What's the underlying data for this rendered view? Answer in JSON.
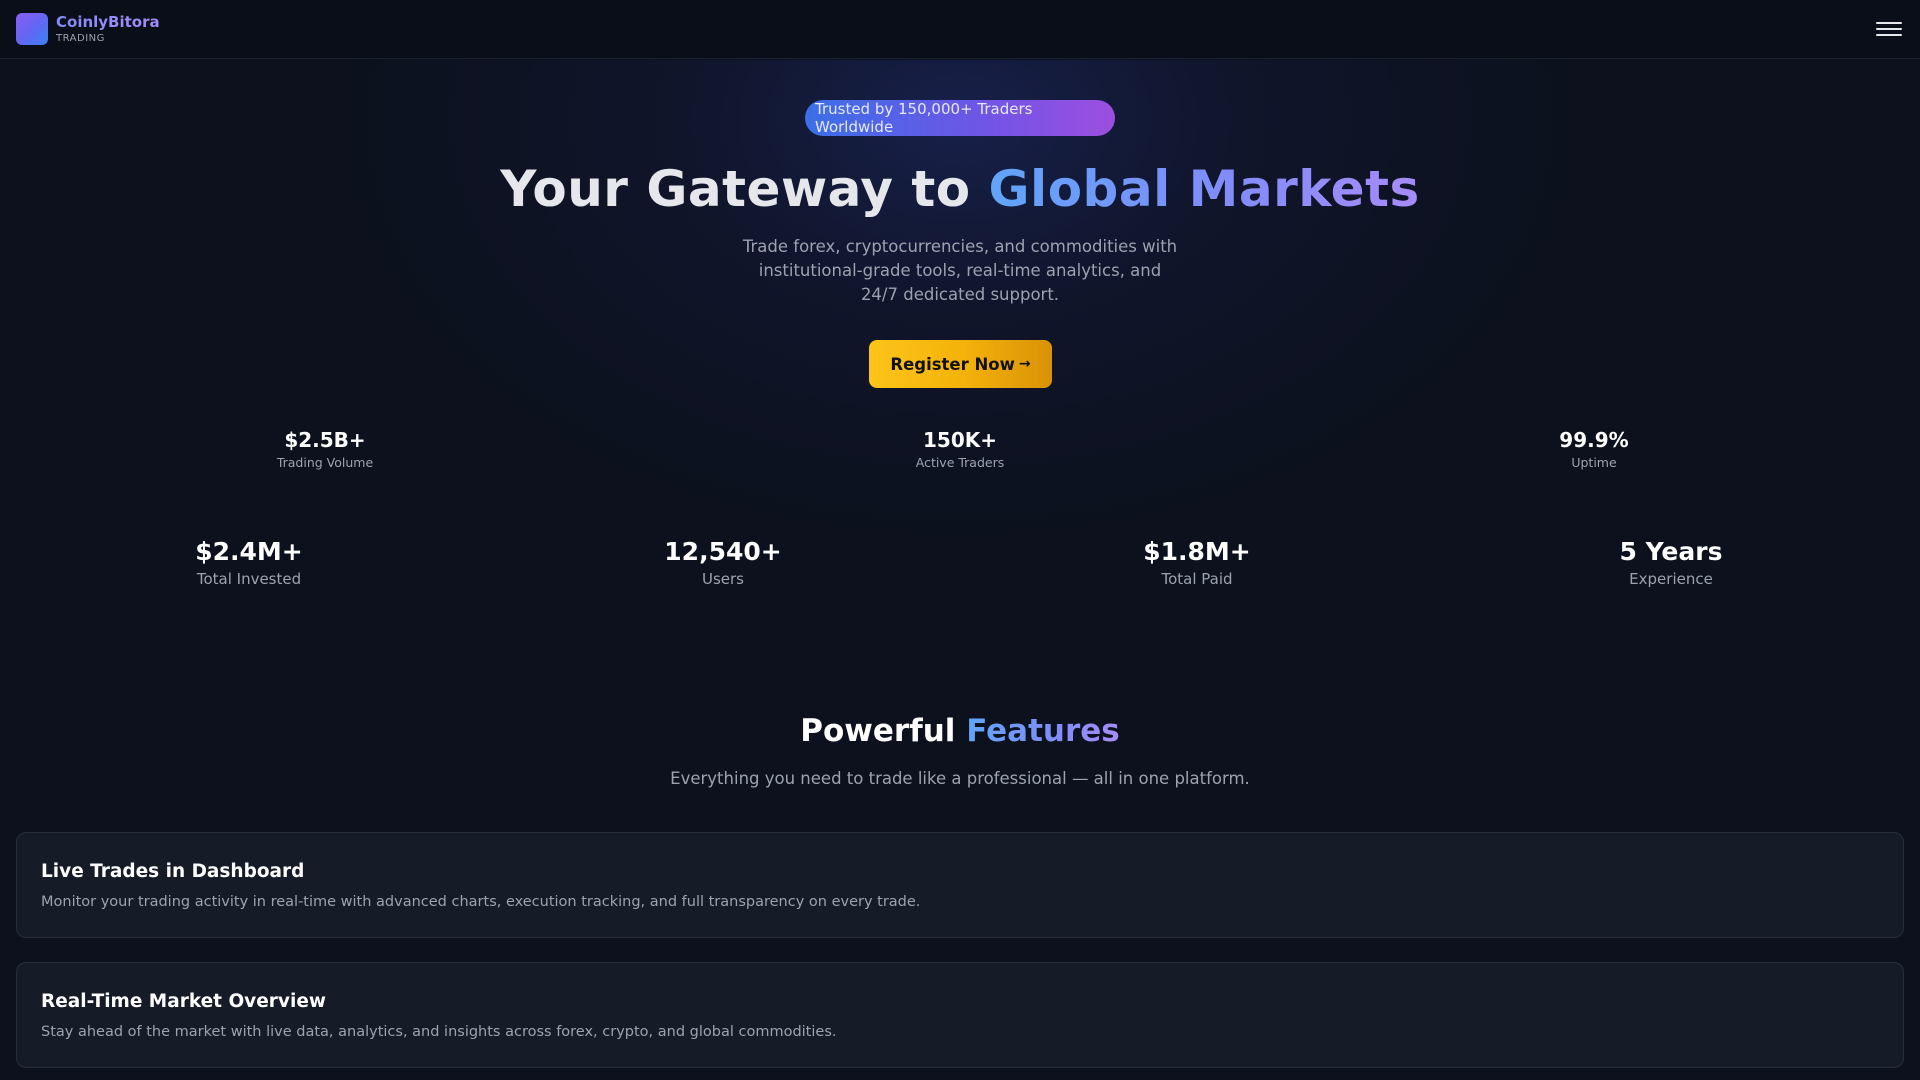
{
  "header": {
    "brand_name": "CoinlyBitora",
    "brand_sub": "TRADING"
  },
  "hero": {
    "badge": "Trusted by 150,000+ Traders Worldwide",
    "title_plain": "Your Gateway to ",
    "title_accent": "Global Markets",
    "subtitle": "Trade forex, cryptocurrencies, and commodities with institutional-grade tools, real-time analytics, and 24/7 dedicated support.",
    "cta_label": "Register Now",
    "cta_arrow": "→",
    "stats": [
      {
        "value": "$2.5B+",
        "label": "Trading Volume"
      },
      {
        "value": "150K+",
        "label": "Active Traders"
      },
      {
        "value": "99.9%",
        "label": "Uptime"
      }
    ]
  },
  "stats": [
    {
      "value": "$2.4M+",
      "label": "Total Invested"
    },
    {
      "value": "12,540+",
      "label": "Users"
    },
    {
      "value": "$1.8M+",
      "label": "Total Paid"
    },
    {
      "value": "5 Years",
      "label": "Experience"
    }
  ],
  "features": {
    "title_plain": "Powerful ",
    "title_accent": "Features",
    "subtitle": "Everything you need to trade like a professional — all in one platform.",
    "cards": [
      {
        "title": "Live Trades in Dashboard",
        "description": "Monitor your trading activity in real-time with advanced charts, execution tracking, and full transparency on every trade."
      },
      {
        "title": "Real-Time Market Overview",
        "description": "Stay ahead of the market with live data, analytics, and insights across forex, crypto, and global commodities."
      }
    ]
  },
  "colors": {
    "background": "#0c111d",
    "accent_blue": "#60a5fa",
    "accent_purple": "#a78bfa",
    "cta_yellow": "#fcc419"
  },
  "icons": {
    "logo": "brand-logo-gradient-square",
    "menu": "hamburger-menu-icon",
    "cta_arrow": "arrow-right-icon"
  }
}
